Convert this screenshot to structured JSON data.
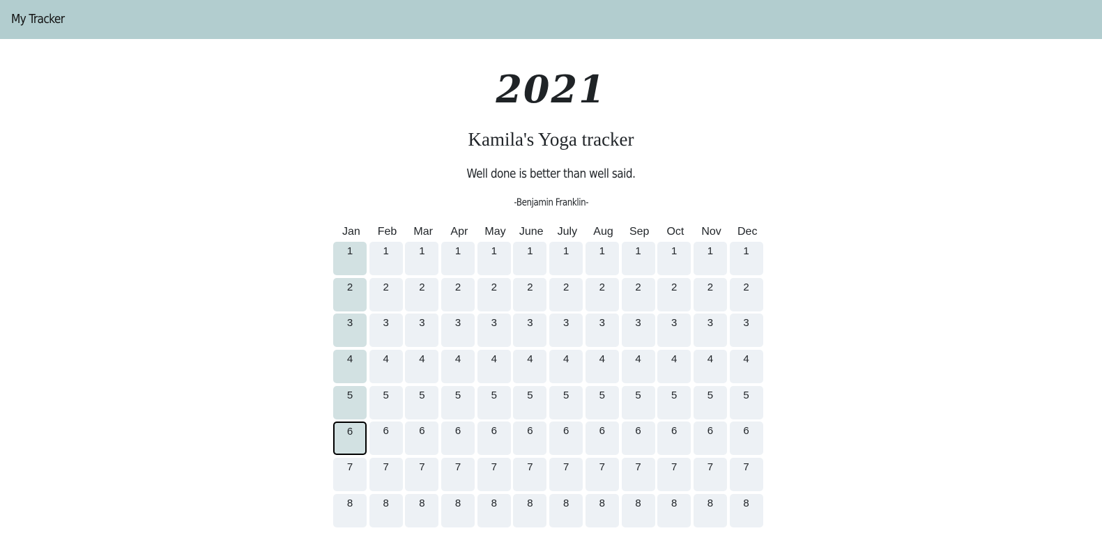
{
  "navbar": {
    "brand": "My Tracker",
    "bg_color": "#b2cdcf"
  },
  "header": {
    "year": "2021",
    "title": "Kamila's Yoga tracker",
    "quote": "Well done is better than well said.",
    "author": "-Benjamin Franklin-"
  },
  "tracker": {
    "months": [
      "Jan",
      "Feb",
      "Mar",
      "Apr",
      "May",
      "June",
      "July",
      "Aug",
      "Sep",
      "Oct",
      "Nov",
      "Dec"
    ],
    "days": [
      1,
      2,
      3,
      4,
      5,
      6,
      7,
      8
    ],
    "completed": {
      "Jan": [
        1,
        2,
        3,
        4,
        5,
        6
      ]
    },
    "selected": {
      "month": "Jan",
      "day": 6
    },
    "colors": {
      "empty": "#edf1f5",
      "completed": "#d2e1e2",
      "selected_border": "#000000"
    }
  }
}
